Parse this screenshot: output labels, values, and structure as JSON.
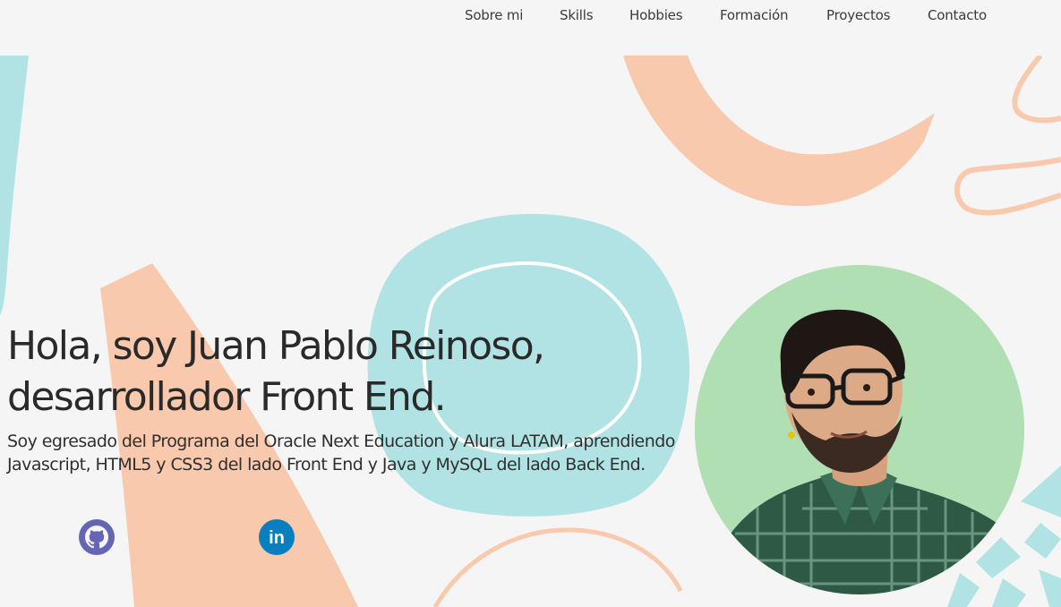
{
  "nav": {
    "items": [
      {
        "label": "Sobre mi"
      },
      {
        "label": "Skills"
      },
      {
        "label": "Hobbies"
      },
      {
        "label": "Formación"
      },
      {
        "label": "Proyectos"
      },
      {
        "label": "Contacto"
      }
    ]
  },
  "hero": {
    "title_line1": "Hola, soy Juan Pablo Reinoso,",
    "title_line2": "desarrollador Front End.",
    "subtitle": "Soy egresado del Programa del Oracle Next Education y Alura LATAM, aprendiendo Javascript, HTML5 y CSS3 del lado Front End y Java y MySQL del lado Back End."
  },
  "social": {
    "github": {
      "icon": "github-icon"
    },
    "linkedin": {
      "icon": "linkedin-icon",
      "text": "in"
    }
  },
  "profile": {
    "image": "profile-photo"
  },
  "colors": {
    "background": "#f5f5f5",
    "teal": "#b2e3e4",
    "peach": "#f8c9ac",
    "green_circle": "#b1dfb4",
    "text": "#2a2a2a",
    "github": "#6566b3",
    "linkedin": "#0a7fc0"
  }
}
